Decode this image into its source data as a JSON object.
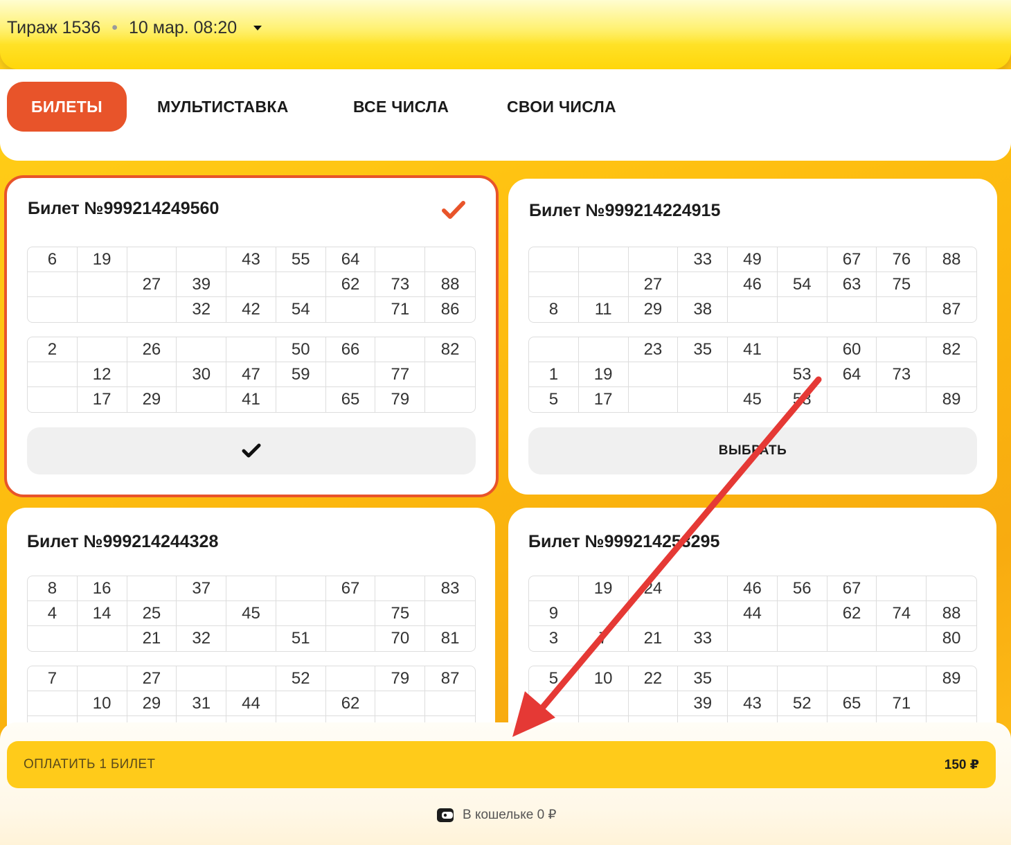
{
  "header": {
    "draw_label": "Тираж 1536",
    "draw_separator": "•",
    "draw_date": "10 мар. 08:20"
  },
  "tabs": [
    {
      "label": "БИЛЕТЫ",
      "active": true
    },
    {
      "label": "МУЛЬТИСТАВКА"
    },
    {
      "label": "ВСЕ ЧИСЛА"
    },
    {
      "label": "СВОИ ЧИСЛА"
    }
  ],
  "tickets": [
    {
      "title": "Билет №999214249560",
      "selected": true,
      "button_label": "",
      "fields": [
        [
          [
            "6",
            "19",
            "",
            "",
            "43",
            "55",
            "64",
            "",
            ""
          ],
          [
            "",
            "",
            "27",
            "39",
            "",
            "",
            "62",
            "73",
            "88"
          ],
          [
            "",
            "",
            "",
            "32",
            "42",
            "54",
            "",
            "71",
            "86"
          ]
        ],
        [
          [
            "2",
            "",
            "26",
            "",
            "",
            "50",
            "66",
            "",
            "82"
          ],
          [
            "",
            "12",
            "",
            "30",
            "47",
            "59",
            "",
            "77",
            ""
          ],
          [
            "",
            "17",
            "29",
            "",
            "41",
            "",
            "65",
            "79",
            ""
          ]
        ]
      ]
    },
    {
      "title": "Билет №999214224915",
      "selected": false,
      "button_label": "ВЫБРАТЬ",
      "fields": [
        [
          [
            "",
            "",
            "",
            "33",
            "49",
            "",
            "67",
            "76",
            "88"
          ],
          [
            "",
            "",
            "27",
            "",
            "46",
            "54",
            "63",
            "75",
            ""
          ],
          [
            "8",
            "11",
            "29",
            "38",
            "",
            "",
            "",
            "",
            "87"
          ]
        ],
        [
          [
            "",
            "",
            "23",
            "35",
            "41",
            "",
            "60",
            "",
            "82"
          ],
          [
            "1",
            "19",
            "",
            "",
            "",
            "53",
            "64",
            "73",
            ""
          ],
          [
            "5",
            "17",
            "",
            "",
            "45",
            "58",
            "",
            "",
            "89"
          ]
        ]
      ]
    },
    {
      "title": "Билет №999214244328",
      "selected": false,
      "button_label": "",
      "fields": [
        [
          [
            "8",
            "16",
            "",
            "37",
            "",
            "",
            "67",
            "",
            "83"
          ],
          [
            "4",
            "14",
            "25",
            "",
            "45",
            "",
            "",
            "75",
            ""
          ],
          [
            "",
            "",
            "21",
            "32",
            "",
            "51",
            "",
            "70",
            "81"
          ]
        ],
        [
          [
            "7",
            "",
            "27",
            "",
            "",
            "52",
            "",
            "79",
            "87"
          ],
          [
            "",
            "10",
            "29",
            "31",
            "44",
            "",
            "62",
            "",
            ""
          ],
          [
            "",
            "",
            "",
            "",
            "",
            "",
            "",
            "",
            ""
          ]
        ]
      ]
    },
    {
      "title": "Билет №999214253295",
      "selected": false,
      "button_label": "",
      "fields": [
        [
          [
            "",
            "19",
            "24",
            "",
            "46",
            "56",
            "67",
            "",
            ""
          ],
          [
            "9",
            "",
            "",
            "",
            "44",
            "",
            "62",
            "74",
            "88"
          ],
          [
            "3",
            "7",
            "21",
            "33",
            "",
            "",
            "",
            "",
            "80"
          ]
        ],
        [
          [
            "5",
            "10",
            "22",
            "35",
            "",
            "",
            "",
            "",
            "89"
          ],
          [
            "",
            "",
            "",
            "39",
            "43",
            "52",
            "65",
            "71",
            ""
          ],
          [
            "",
            "",
            "",
            "",
            "",
            "",
            "",
            "",
            ""
          ]
        ]
      ]
    }
  ],
  "payment": {
    "label": "ОПЛАТИТЬ 1 БИЛЕТ",
    "price": "150 ₽"
  },
  "wallet": {
    "text": "В кошельке 0 ₽"
  },
  "colors": {
    "accent": "#e8542a",
    "pay_button": "#ffcb1a",
    "annotation_arrow": "#e53935"
  }
}
